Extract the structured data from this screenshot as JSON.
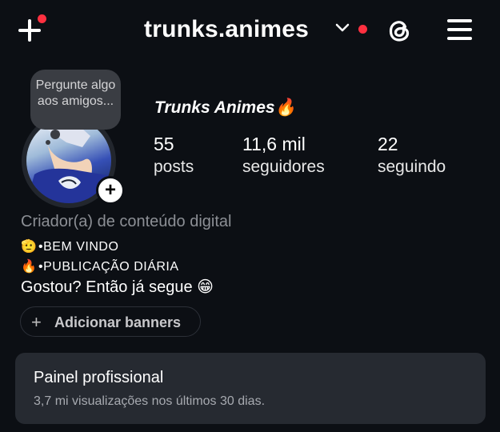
{
  "header": {
    "username": "trunks.animes",
    "create_icon": "plus-icon",
    "switch_icon": "chevron-down-icon",
    "threads_icon": "threads-icon",
    "menu_icon": "hamburger-menu-icon",
    "notification_color": "#ff3040"
  },
  "profile": {
    "note_text": "Pergunte algo aos amigos...",
    "display_name": "Trunks Animes",
    "display_name_emoji": "🔥",
    "stats": [
      {
        "value": "55",
        "label": "posts"
      },
      {
        "value": "11,6 mil",
        "label": "seguidores"
      },
      {
        "value": "22",
        "label": "seguindo"
      }
    ],
    "category": "Criador(a) de conteúdo digital",
    "bio_lines": [
      {
        "emoji": "🫡",
        "text": "•BEM VINDO"
      },
      {
        "emoji": "🔥",
        "text": "•PUBLICAÇÃO DIÁRIA"
      }
    ],
    "bio_main": "Gostou? Então já segue",
    "bio_main_emoji": "😁",
    "add_banners_label": "Adicionar banners"
  },
  "professional_panel": {
    "title": "Painel profissional",
    "subtitle": "3,7 mi visualizações nos últimos 30 dias."
  },
  "colors": {
    "background": "#0c0f14",
    "panel": "#262a31",
    "secondary_text": "#8c8f95"
  }
}
